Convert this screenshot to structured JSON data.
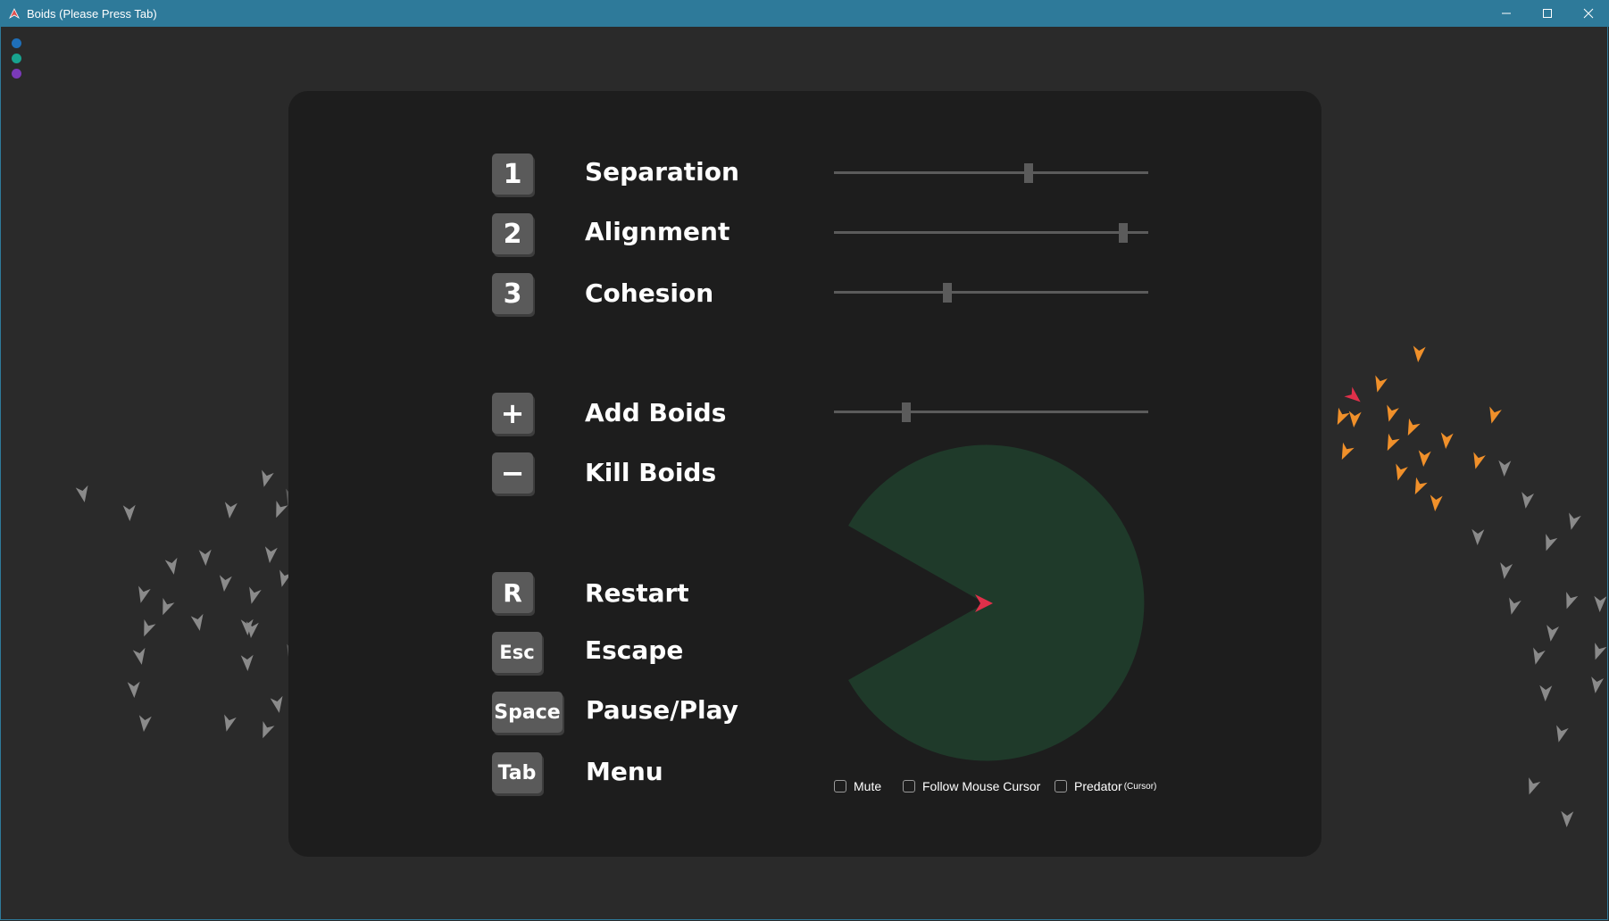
{
  "window": {
    "title": "Boids (Please Press Tab)",
    "titlebar_color": "#2e7a9a",
    "controls": [
      "minimize-icon",
      "maximize-icon",
      "close-icon"
    ]
  },
  "theme_dots": [
    {
      "name": "blue-theme-dot",
      "color": "#1f6fb8"
    },
    {
      "name": "teal-theme-dot",
      "color": "#18a38f"
    },
    {
      "name": "purple-theme-dot",
      "color": "#7a3ab8"
    }
  ],
  "menu": {
    "rows": [
      {
        "id": "separation",
        "key": "1",
        "label": "Separation",
        "slider": 0.62
      },
      {
        "id": "alignment",
        "key": "2",
        "label": "Alignment",
        "slider": 0.92
      },
      {
        "id": "cohesion",
        "key": "3",
        "label": "Cohesion",
        "slider": 0.36
      },
      {
        "id": "add-boids",
        "key": "+",
        "label": "Add Boids",
        "slider": 0.23
      },
      {
        "id": "kill-boids",
        "key": "−",
        "label": "Kill Boids"
      },
      {
        "id": "restart",
        "key": "R",
        "label": "Restart"
      },
      {
        "id": "escape",
        "key": "Esc",
        "label": "Escape"
      },
      {
        "id": "pause-play",
        "key": "Space",
        "label": "Pause/Play"
      },
      {
        "id": "menu",
        "key": "Tab",
        "label": "Menu"
      }
    ],
    "options": [
      {
        "id": "mute",
        "label": "Mute",
        "checked": false
      },
      {
        "id": "follow-mouse-cursor",
        "label": "Follow Mouse Cursor",
        "checked": false
      },
      {
        "id": "predator",
        "label": "Predator",
        "sublabel": "(Cursor)",
        "checked": false
      }
    ],
    "view_cone_color": "#1f3a2a",
    "panel_color": "#1d1d1d"
  },
  "boid_colors": {
    "gray": "#8a8a8a",
    "orange": "#f0902a",
    "red": "#e0304a"
  }
}
